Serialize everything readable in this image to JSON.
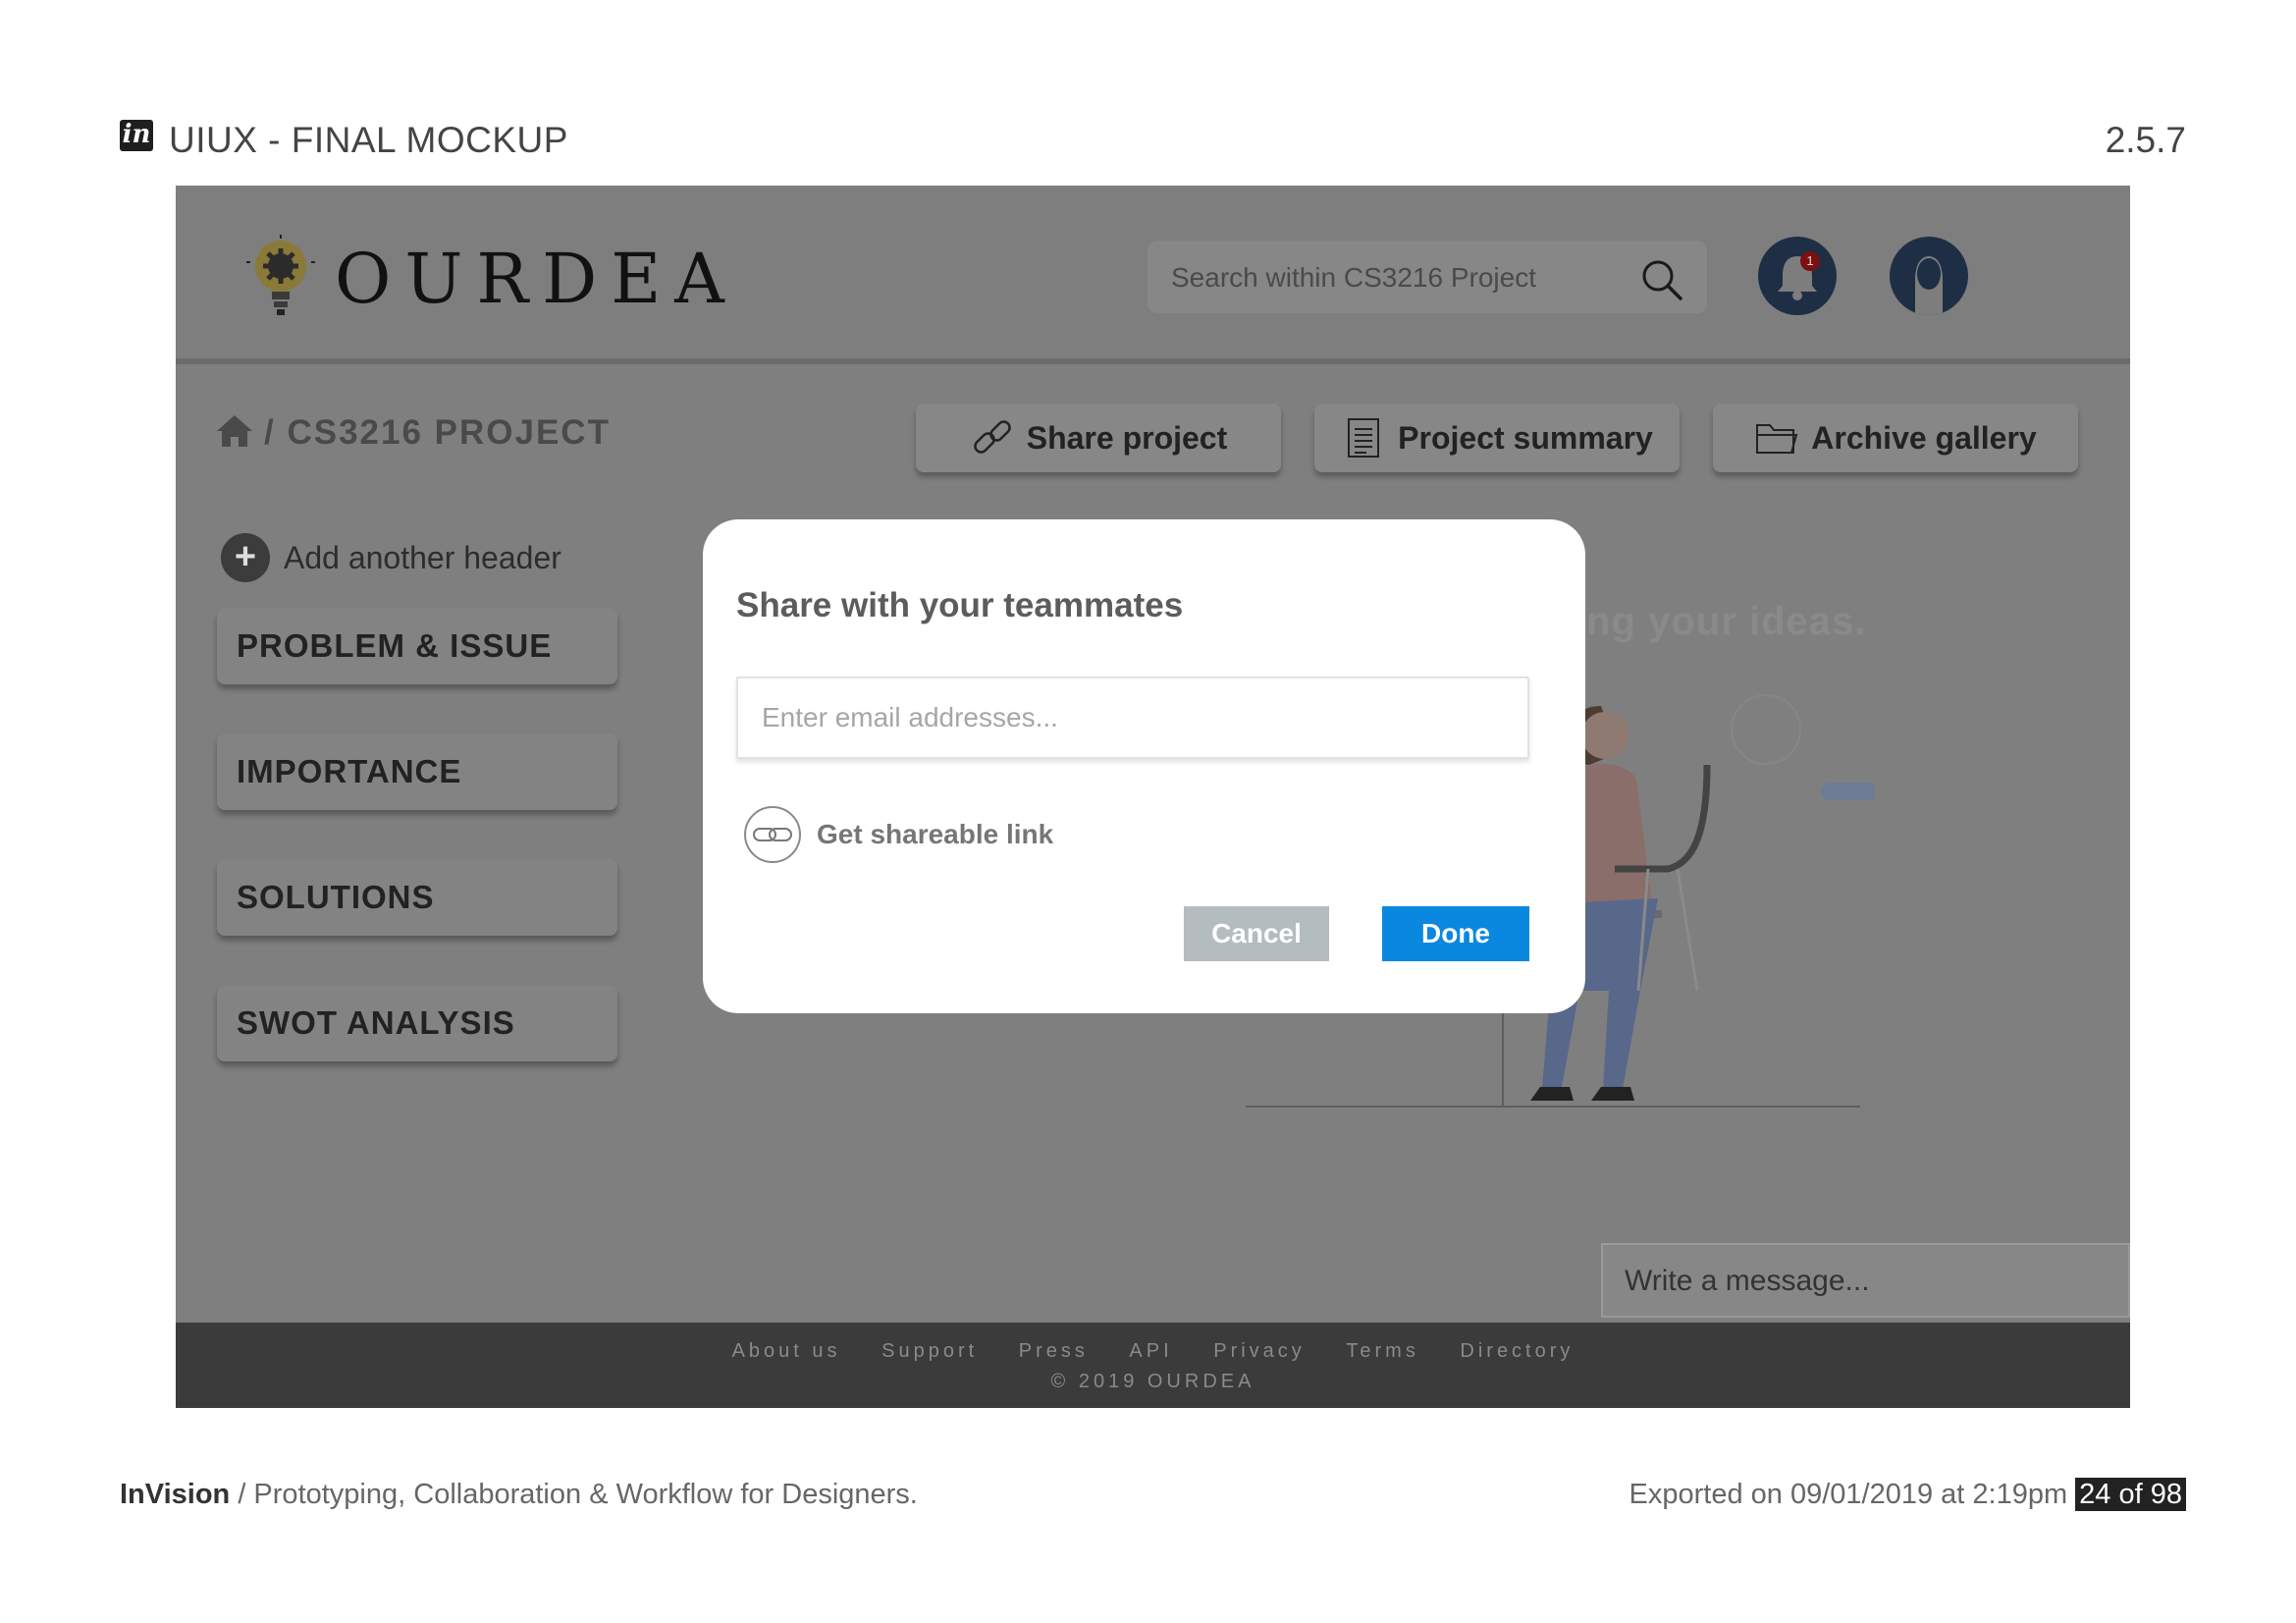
{
  "export_header": {
    "logo_text": "in",
    "title": "UIUX - FINAL MOCKUP",
    "version": "2.5.7"
  },
  "export_footer": {
    "brand": "InVision",
    "tagline": " / Prototyping, Collaboration & Workflow for Designers.",
    "exported": "Exported on 09/01/2019 at 2:19pm ",
    "page": "24 of 98"
  },
  "app": {
    "brand_name": "OURDEA",
    "search": {
      "placeholder": "Search within CS3216 Project"
    },
    "notification_count": "1",
    "breadcrumb": "/ CS3216 PROJECT",
    "toolbar": {
      "share_label": "Share project",
      "summary_label": "Project summary",
      "archive_label": "Archive gallery"
    },
    "sidebar": {
      "add_header_label": "Add another header",
      "sections": [
        "PROBLEM & ISSUE",
        "IMPORTANCE",
        "SOLUTIONS",
        "SWOT ANALYSIS"
      ]
    },
    "background_caption": "ing your ideas.",
    "chat": {
      "placeholder": "Write a message..."
    },
    "footer": {
      "links": [
        "About us",
        "Support",
        "Press",
        "API",
        "Privacy",
        "Terms",
        "Directory"
      ],
      "copyright": "© 2019 OURDEA"
    }
  },
  "modal": {
    "title": "Share with your teammates",
    "email_placeholder": "Enter email addresses...",
    "share_link_label": "Get shareable link",
    "cancel_label": "Cancel",
    "done_label": "Done"
  },
  "colors": {
    "overlay_gray": "#7f7f7f",
    "done_blue": "#0a88e0",
    "cancel_gray": "#b3bcbf",
    "footer_dark": "#3b3b3b",
    "icon_navy": "#1e2e44"
  },
  "icons": [
    "invision-logo",
    "lightbulb-gear-logo",
    "search-icon",
    "bell-icon",
    "user-avatar-icon",
    "home-icon",
    "link-icon",
    "document-icon",
    "folder-icon",
    "plus-icon"
  ]
}
